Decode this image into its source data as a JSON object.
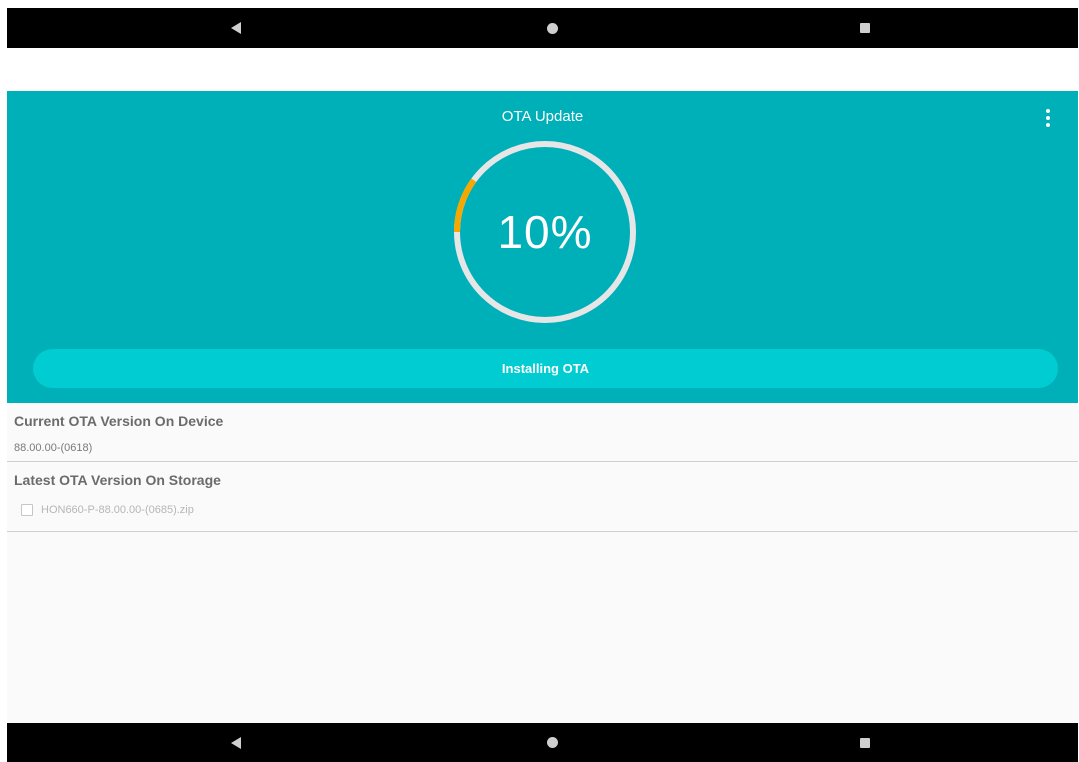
{
  "app": {
    "title": "OTA Update",
    "progress_percent_label": "10%",
    "progress_fraction": 0.1,
    "install_button_label": "Installing OTA"
  },
  "current_section": {
    "title": "Current OTA Version On Device",
    "value": "88.00.00-(0618)"
  },
  "latest_section": {
    "title": "Latest OTA Version On Storage",
    "file_name": "HON660-P-88.00.00-(0685).zip",
    "checked": false
  },
  "colors": {
    "header": "#00b0b9",
    "button": "#00ccd1",
    "ring_track": "#e6e6e6",
    "ring_progress": "#f5a800"
  },
  "icons": {
    "nav_back": "back-triangle-icon",
    "nav_home": "home-circle-icon",
    "nav_recents": "recents-square-icon",
    "overflow": "more-vert-icon"
  }
}
